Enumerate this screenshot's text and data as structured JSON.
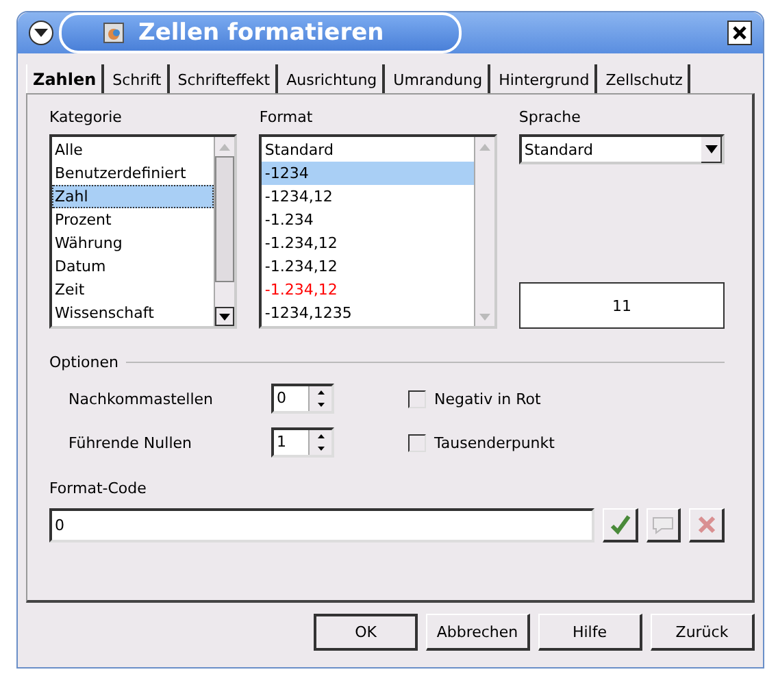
{
  "window": {
    "title": "Zellen formatieren"
  },
  "tabs": [
    {
      "label": "Zahlen",
      "selected": true
    },
    {
      "label": "Schrift",
      "selected": false
    },
    {
      "label": "Schrifteffekt",
      "selected": false
    },
    {
      "label": "Ausrichtung",
      "selected": false
    },
    {
      "label": "Umrandung",
      "selected": false
    },
    {
      "label": "Hintergrund",
      "selected": false
    },
    {
      "label": "Zellschutz",
      "selected": false
    }
  ],
  "kategorie": {
    "label": "Kategorie",
    "items": [
      {
        "label": "Alle",
        "selected": false
      },
      {
        "label": "Benutzerdefiniert",
        "selected": false
      },
      {
        "label": "Zahl",
        "selected": true
      },
      {
        "label": "Prozent",
        "selected": false
      },
      {
        "label": "Währung",
        "selected": false
      },
      {
        "label": "Datum",
        "selected": false
      },
      {
        "label": "Zeit",
        "selected": false
      },
      {
        "label": "Wissenschaft",
        "selected": false
      }
    ]
  },
  "format": {
    "label": "Format",
    "items": [
      {
        "label": "Standard",
        "selected": false,
        "kind": "normal"
      },
      {
        "label": "-1234",
        "selected": true,
        "kind": "normal"
      },
      {
        "label": "-1234,12",
        "selected": false,
        "kind": "normal"
      },
      {
        "label": "-1.234",
        "selected": false,
        "kind": "normal"
      },
      {
        "label": "-1.234,12",
        "selected": false,
        "kind": "normal"
      },
      {
        "label": "-1.234,12",
        "selected": false,
        "kind": "normal"
      },
      {
        "label": "-1.234,12",
        "selected": false,
        "kind": "negative"
      },
      {
        "label": "-1234,1235",
        "selected": false,
        "kind": "normal"
      }
    ]
  },
  "sprache": {
    "label": "Sprache",
    "value": "Standard"
  },
  "preview": "11",
  "optionen": {
    "title": "Optionen",
    "spinners": [
      {
        "label": "Nachkommastellen",
        "value": "0"
      },
      {
        "label": "Führende Nullen",
        "value": "1"
      }
    ],
    "checkboxes": [
      {
        "label": "Negativ in Rot",
        "checked": false
      },
      {
        "label": "Tausenderpunkt",
        "checked": false
      }
    ]
  },
  "format_code": {
    "label": "Format-Code",
    "value": "0",
    "actions": [
      {
        "kind": "accept",
        "disabled": false
      },
      {
        "kind": "comment",
        "disabled": true
      },
      {
        "kind": "delete",
        "disabled": true
      }
    ]
  },
  "buttons": [
    "OK",
    "Abbrechen",
    "Hilfe",
    "Zurück"
  ]
}
